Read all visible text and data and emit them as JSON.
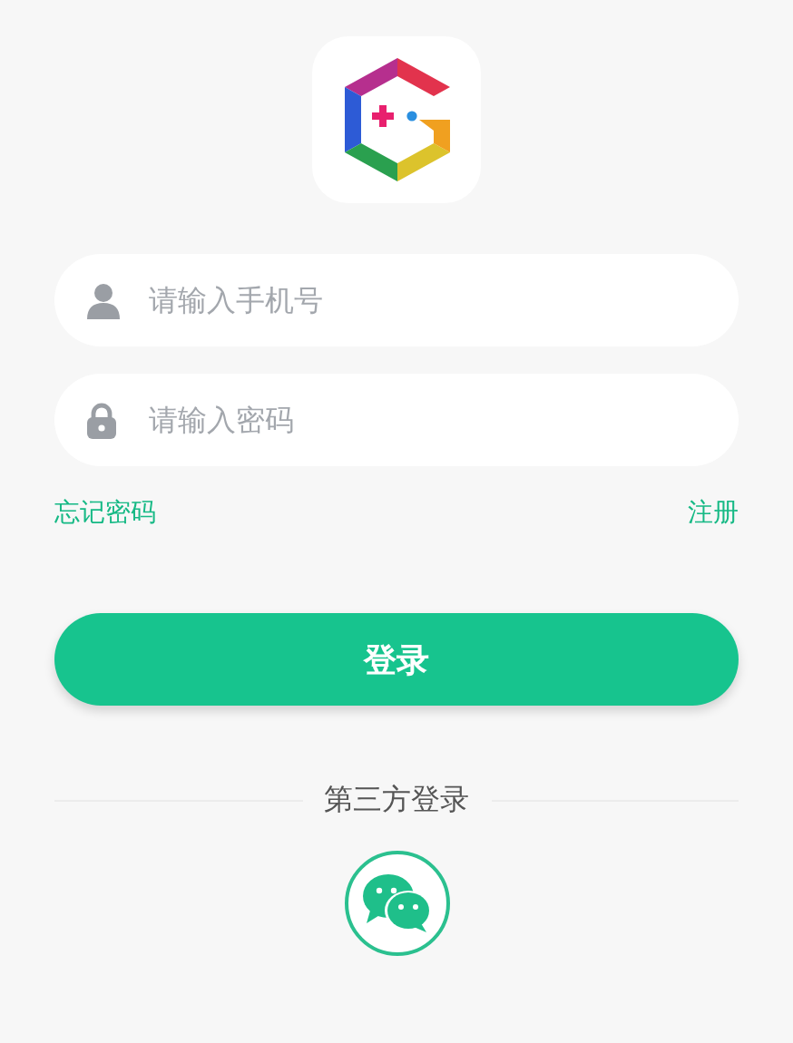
{
  "fields": [
    {
      "kind": "phone",
      "placeholder": "请输入手机号"
    },
    {
      "kind": "password",
      "placeholder": "请输入密码"
    }
  ],
  "links": {
    "forgot": "忘记密码",
    "register": "注册"
  },
  "login_button": "登录",
  "third_party": {
    "title": "第三方登录"
  }
}
